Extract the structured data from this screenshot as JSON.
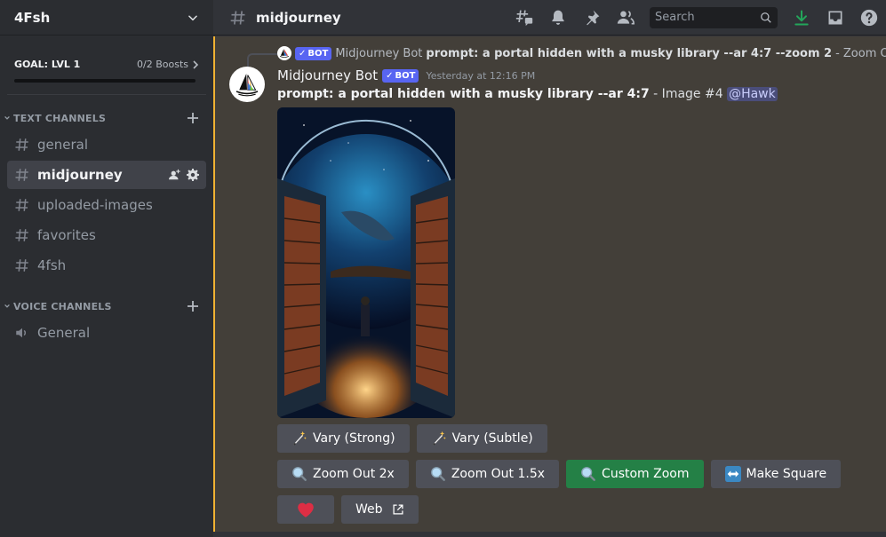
{
  "server": {
    "name": "4Fsh",
    "boost_goal": "GOAL: LVL 1",
    "boost_count": "0/2 Boosts",
    "boost_progress": 0
  },
  "categories": {
    "text": {
      "label": "TEXT CHANNELS",
      "channels": [
        {
          "name": "general",
          "active": false
        },
        {
          "name": "midjourney",
          "active": true
        },
        {
          "name": "uploaded-images",
          "active": false
        },
        {
          "name": "favorites",
          "active": false
        },
        {
          "name": "4fsh",
          "active": false
        }
      ]
    },
    "voice": {
      "label": "VOICE CHANNELS",
      "channels": [
        {
          "name": "General"
        }
      ]
    }
  },
  "topbar": {
    "channel": "midjourney",
    "search_placeholder": "Search",
    "icons": [
      "threads-icon",
      "bell-icon",
      "pin-icon",
      "members-icon",
      "download-icon",
      "inbox-icon",
      "help-icon"
    ]
  },
  "reply": {
    "author": "Midjourney Bot",
    "bot_tag": "BOT",
    "prompt": "prompt: a portal hidden with a musky library --ar 4:7 --zoom 2",
    "suffix": " - Zoom Ou"
  },
  "message": {
    "author": "Midjourney Bot",
    "bot_tag": "BOT",
    "timestamp": "Yesterday at 12:16 PM",
    "prompt": "prompt: a portal hidden with a musky library --ar 4:7",
    "suffix": " - Image #4 ",
    "mention": "@Hawk",
    "image_alt": "A figure standing between two bookshelf doors beneath a cosmic sky with a whale"
  },
  "buttons": {
    "row1": [
      {
        "label": "Vary (Strong)",
        "icon": "magic-wand-icon",
        "style": "secondary"
      },
      {
        "label": "Vary (Subtle)",
        "icon": "magic-wand-icon",
        "style": "secondary"
      }
    ],
    "row2": [
      {
        "label": "Zoom Out 2x",
        "icon": "magnifier-icon",
        "style": "secondary"
      },
      {
        "label": "Zoom Out 1.5x",
        "icon": "magnifier-icon",
        "style": "secondary"
      },
      {
        "label": "Custom Zoom",
        "icon": "magnifier-icon",
        "style": "success"
      },
      {
        "label": "Make Square",
        "icon": "left-right-arrow-icon",
        "style": "secondary"
      }
    ],
    "row3": [
      {
        "label": "",
        "icon": "heart-icon",
        "style": "secondary"
      },
      {
        "label": "Web",
        "icon": "external-link-icon",
        "style": "secondary"
      }
    ]
  },
  "colors": {
    "accent": "#5865f2",
    "success": "#248046",
    "highlight_border": "#f0b232",
    "highlight_bg": "#433f39",
    "download_green": "#23a55a",
    "heart": "#da373c"
  }
}
